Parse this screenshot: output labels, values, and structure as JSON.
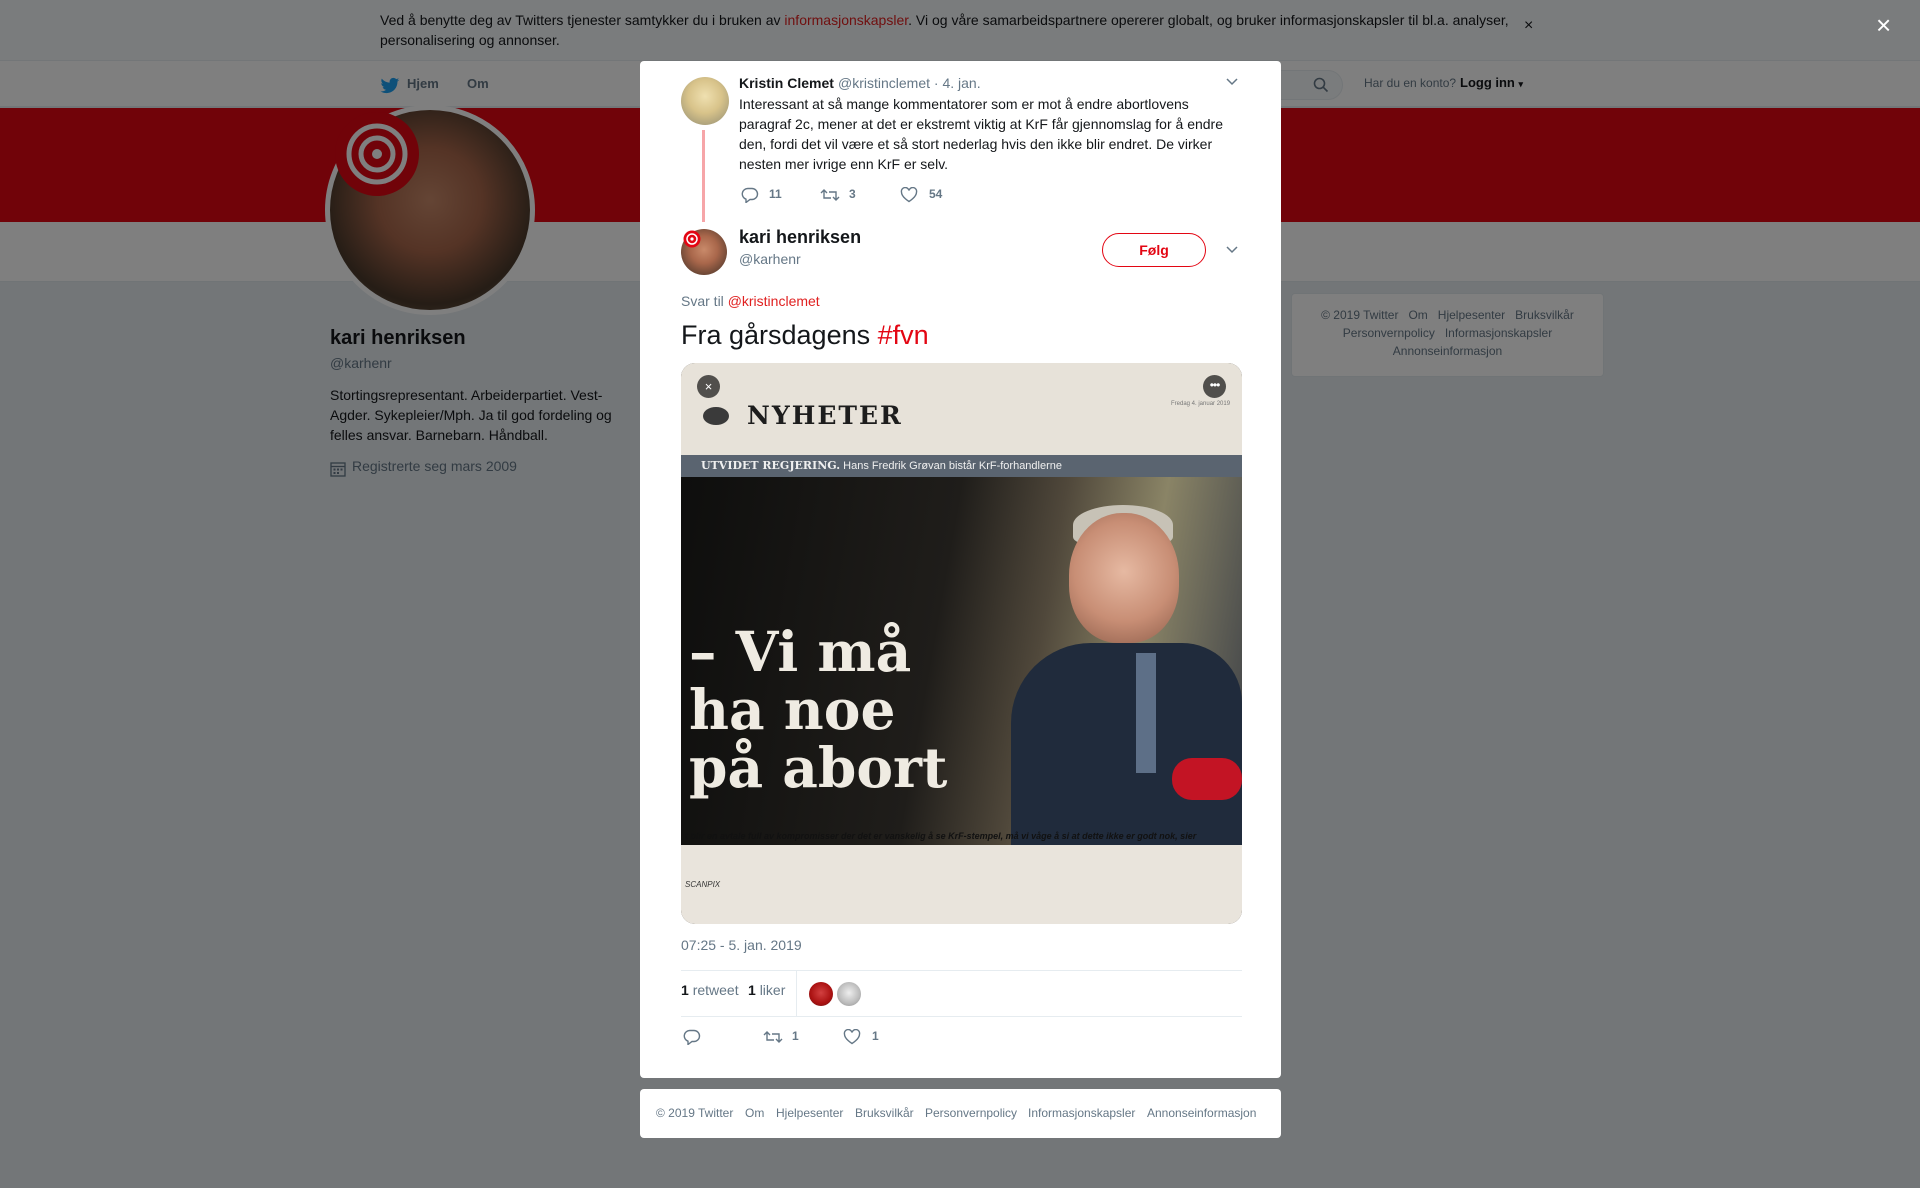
{
  "cookie": {
    "text_before": "Ved å benytte deg av Twitters tjenester samtykker du i bruken av ",
    "link": "informasjonskapsler",
    "text_after": ". Vi og våre samarbeidspartnere opererer globalt, og bruker informasjonskapsler til bl.a. analyser, personalisering og annonser.",
    "close": "×"
  },
  "nav": {
    "home": "Hjem",
    "about": "Om",
    "account_question": "Har du en konto?",
    "login": "Logg inn"
  },
  "profile": {
    "name": "kari henriksen",
    "handle": "@karhenr",
    "bio": "Stortingsrepresentant. Arbeiderpartiet. Vest-Agder. Sykepleier/Mph. Ja til god fordeling og felles ansvar. Barnebarn. Håndball.",
    "joined": "Registrerte seg mars 2009"
  },
  "side_footer": [
    "© 2019 Twitter",
    "Om",
    "Hjelpesenter",
    "Bruksvilkår",
    "Personvernpolicy",
    "Informasjonskapsler",
    "Annonseinformasjon"
  ],
  "overlay_close": "×",
  "parent_tweet": {
    "name": "Kristin Clemet",
    "handle": "@kristinclemet · 4. jan.",
    "text": "Interessant at så mange kommentatorer som er mot å endre abortlovens paragraf 2c, mener at det er ekstremt viktig at KrF får gjennomslag for å endre den, fordi det vil være et så stort nederlag hvis den ikke blir endret. De virker nesten mer ivrige enn KrF er selv.",
    "replies": "11",
    "retweets": "3",
    "likes": "54"
  },
  "tweet": {
    "name": "kari henriksen",
    "handle": "@karhenr",
    "follow": "Følg",
    "reply_prefix": "Svar til ",
    "reply_handle": "@kristinclemet",
    "text": "Fra gårsdagens ",
    "hashtag": "#fvn",
    "timestamp": "07:25 - 5. jan. 2019",
    "retweet_count": "1",
    "retweet_label": "retweet",
    "like_count": "1",
    "like_label": "liker",
    "action_retweets": "1",
    "action_likes": "1"
  },
  "media": {
    "close": "×",
    "more": "•••",
    "masthead": "NYHETER",
    "date": "Fredag 4. januar 2019",
    "strip_bold": "UTVIDET REGJERING.",
    "strip_rest": " Hans Fredrik Grøvan bistår KrF-forhandlerne",
    "headline_1": "– Vi må",
    "headline_2": "ha noe",
    "headline_3": "på abort",
    "caption": "t blir en avtale full av kompromisser der det er vanskelig å se KrF-stempel, må vi våge å si at dette ikke er godt nok, sier",
    "credit": "SCANPIX"
  },
  "modal_footer": [
    "© 2019 Twitter",
    "Om",
    "Hjelpesenter",
    "Bruksvilkår",
    "Personvernpolicy",
    "Informasjonskapsler",
    "Annonseinformasjon"
  ],
  "colors": {
    "accent": "#e30613",
    "link": "#e02020",
    "muted": "#657786",
    "thread": "#f6a5a8"
  }
}
